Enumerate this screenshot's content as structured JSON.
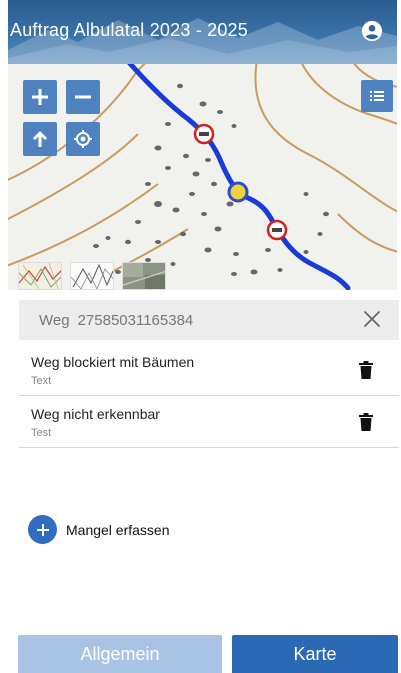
{
  "header": {
    "title": "Auftrag Albulatal 2023 - 2025",
    "account_icon": "account-circle-icon"
  },
  "map": {
    "controls": {
      "zoom_in_icon": "plus-icon",
      "zoom_out_icon": "minus-icon",
      "north_icon": "arrow-up-icon",
      "locate_icon": "crosshair-icon",
      "layers_icon": "list-icon"
    },
    "basemaps": [
      "map-thumbnail-topo",
      "map-thumbnail-contour",
      "map-thumbnail-aerial"
    ],
    "route_color": "#1a3bd6"
  },
  "detail": {
    "type": "Weg",
    "id": "27585031165384"
  },
  "issues": [
    {
      "title": "Weg blockiert mit Bäumen",
      "subtitle": "Text"
    },
    {
      "title": "Weg nicht erkennbar",
      "subtitle": "Test"
    }
  ],
  "add": {
    "label": "Mangel erfassen"
  },
  "tabs": {
    "general": "Allgemein",
    "map": "Karte"
  },
  "colors": {
    "accent": "#2a6ab5",
    "accent_light": "#a8c3e3",
    "map_button": "#4f83c0",
    "add_button": "#2f6cc2"
  }
}
